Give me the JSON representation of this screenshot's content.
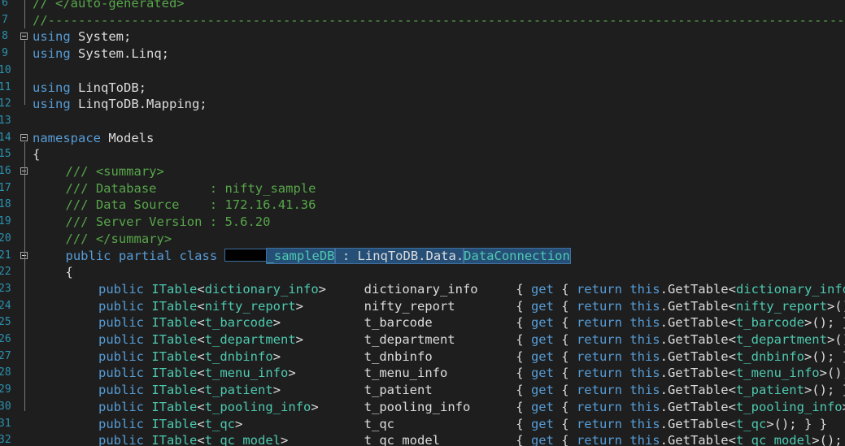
{
  "theme": {
    "background": "#1e1e1e",
    "keyword": "#569cd6",
    "comment": "#57a64a",
    "type": "#4ec9b0",
    "text": "#dcdcdc",
    "line_number": "#2b91af",
    "selection": "#264f78"
  },
  "lines": [
    {
      "num": "6",
      "fold": false,
      "indent": 0,
      "tokens": [
        {
          "t": "// </auto-generated>",
          "c": "cm"
        }
      ]
    },
    {
      "num": "7",
      "fold": false,
      "indent": 0,
      "tokens": [
        {
          "t": "//---------------------------------------------------------------------------------------------------------",
          "c": "cm"
        }
      ]
    },
    {
      "num": "8",
      "fold": true,
      "indent": 0,
      "tokens": [
        {
          "t": "using",
          "c": "kw"
        },
        {
          "t": " System;",
          "c": "tx"
        }
      ]
    },
    {
      "num": "9",
      "fold": false,
      "indent": 0,
      "tokens": [
        {
          "t": "using",
          "c": "kw"
        },
        {
          "t": " System.Linq;",
          "c": "tx"
        }
      ]
    },
    {
      "num": "10",
      "fold": false,
      "indent": 0,
      "tokens": []
    },
    {
      "num": "11",
      "fold": false,
      "indent": 0,
      "tokens": [
        {
          "t": "using",
          "c": "kw"
        },
        {
          "t": " LinqToDB;",
          "c": "tx"
        }
      ]
    },
    {
      "num": "12",
      "fold": false,
      "indent": 0,
      "tokens": [
        {
          "t": "using",
          "c": "kw"
        },
        {
          "t": " LinqToDB.Mapping;",
          "c": "tx"
        }
      ]
    },
    {
      "num": "13",
      "fold": false,
      "indent": 0,
      "tokens": []
    },
    {
      "num": "14",
      "fold": true,
      "indent": 0,
      "tokens": [
        {
          "t": "namespace",
          "c": "kw"
        },
        {
          "t": " Models",
          "c": "tx"
        }
      ]
    },
    {
      "num": "15",
      "fold": false,
      "indent": 0,
      "tokens": [
        {
          "t": "{",
          "c": "tx"
        }
      ]
    },
    {
      "num": "16",
      "fold": true,
      "indent": 1,
      "tokens": [
        {
          "t": "/// <summary>",
          "c": "cm"
        }
      ]
    },
    {
      "num": "17",
      "fold": false,
      "indent": 1,
      "tokens": [
        {
          "t": "/// Database       : nifty_sample",
          "c": "cm"
        }
      ]
    },
    {
      "num": "18",
      "fold": false,
      "indent": 1,
      "tokens": [
        {
          "t": "/// Data Source    : 172.16.41.36",
          "c": "cm"
        }
      ]
    },
    {
      "num": "19",
      "fold": false,
      "indent": 1,
      "tokens": [
        {
          "t": "/// Server Version : 5.6.20",
          "c": "cm"
        }
      ]
    },
    {
      "num": "20",
      "fold": false,
      "indent": 1,
      "tokens": [
        {
          "t": "/// </summary>",
          "c": "cm"
        }
      ]
    },
    {
      "num": "21",
      "fold": true,
      "indent": 1,
      "tokens": [
        {
          "t": "public",
          "c": "kw"
        },
        {
          "t": " ",
          "c": "tx"
        },
        {
          "t": "partial",
          "c": "kw"
        },
        {
          "t": " ",
          "c": "tx"
        },
        {
          "t": "class",
          "c": "kw"
        },
        {
          "t": " ",
          "c": "tx"
        },
        {
          "t": "",
          "c": "redact"
        },
        {
          "t": "_sampleDB",
          "c": "ty sel"
        },
        {
          "t": " : LinqToDB.Data.",
          "c": "tx sel"
        },
        {
          "t": "DataConnection",
          "c": "ty sel"
        }
      ]
    },
    {
      "num": "22",
      "fold": false,
      "indent": 1,
      "tokens": [
        {
          "t": "{",
          "c": "tx"
        }
      ]
    },
    {
      "num": "23",
      "fold": false,
      "indent": 2,
      "tokens": [
        {
          "t": "public",
          "c": "kw"
        },
        {
          "t": " ",
          "c": "tx"
        },
        {
          "t": "ITable",
          "c": "ty"
        },
        {
          "t": "<",
          "c": "tx"
        },
        {
          "t": "dictionary_info",
          "c": "ty"
        },
        {
          "t": ">     dictionary_info     { ",
          "c": "tx"
        },
        {
          "t": "get",
          "c": "kw"
        },
        {
          "t": " { ",
          "c": "tx"
        },
        {
          "t": "return",
          "c": "kw"
        },
        {
          "t": " ",
          "c": "tx"
        },
        {
          "t": "this",
          "c": "kw"
        },
        {
          "t": ".GetTable<",
          "c": "tx"
        },
        {
          "t": "dictionary_info",
          "c": "ty"
        },
        {
          "t": ">(); } }",
          "c": "tx"
        }
      ]
    },
    {
      "num": "24",
      "fold": false,
      "indent": 2,
      "tokens": [
        {
          "t": "public",
          "c": "kw"
        },
        {
          "t": " ",
          "c": "tx"
        },
        {
          "t": "ITable",
          "c": "ty"
        },
        {
          "t": "<",
          "c": "tx"
        },
        {
          "t": "nifty_report",
          "c": "ty"
        },
        {
          "t": ">        nifty_report        { ",
          "c": "tx"
        },
        {
          "t": "get",
          "c": "kw"
        },
        {
          "t": " { ",
          "c": "tx"
        },
        {
          "t": "return",
          "c": "kw"
        },
        {
          "t": " ",
          "c": "tx"
        },
        {
          "t": "this",
          "c": "kw"
        },
        {
          "t": ".GetTable<",
          "c": "tx"
        },
        {
          "t": "nifty_report",
          "c": "ty"
        },
        {
          "t": ">(); } }",
          "c": "tx"
        }
      ]
    },
    {
      "num": "25",
      "fold": false,
      "indent": 2,
      "tokens": [
        {
          "t": "public",
          "c": "kw"
        },
        {
          "t": " ",
          "c": "tx"
        },
        {
          "t": "ITable",
          "c": "ty"
        },
        {
          "t": "<",
          "c": "tx"
        },
        {
          "t": "t_barcode",
          "c": "ty"
        },
        {
          "t": ">           t_barcode           { ",
          "c": "tx"
        },
        {
          "t": "get",
          "c": "kw"
        },
        {
          "t": " { ",
          "c": "tx"
        },
        {
          "t": "return",
          "c": "kw"
        },
        {
          "t": " ",
          "c": "tx"
        },
        {
          "t": "this",
          "c": "kw"
        },
        {
          "t": ".GetTable<",
          "c": "tx"
        },
        {
          "t": "t_barcode",
          "c": "ty"
        },
        {
          "t": ">(); } }",
          "c": "tx"
        }
      ]
    },
    {
      "num": "26",
      "fold": false,
      "indent": 2,
      "tokens": [
        {
          "t": "public",
          "c": "kw"
        },
        {
          "t": " ",
          "c": "tx"
        },
        {
          "t": "ITable",
          "c": "ty"
        },
        {
          "t": "<",
          "c": "tx"
        },
        {
          "t": "t_department",
          "c": "ty"
        },
        {
          "t": ">        t_department        { ",
          "c": "tx"
        },
        {
          "t": "get",
          "c": "kw"
        },
        {
          "t": " { ",
          "c": "tx"
        },
        {
          "t": "return",
          "c": "kw"
        },
        {
          "t": " ",
          "c": "tx"
        },
        {
          "t": "this",
          "c": "kw"
        },
        {
          "t": ".GetTable<",
          "c": "tx"
        },
        {
          "t": "t_department",
          "c": "ty"
        },
        {
          "t": ">(); } }",
          "c": "tx"
        }
      ]
    },
    {
      "num": "27",
      "fold": false,
      "indent": 2,
      "tokens": [
        {
          "t": "public",
          "c": "kw"
        },
        {
          "t": " ",
          "c": "tx"
        },
        {
          "t": "ITable",
          "c": "ty"
        },
        {
          "t": "<",
          "c": "tx"
        },
        {
          "t": "t_dnbinfo",
          "c": "ty"
        },
        {
          "t": ">           t_dnbinfo           { ",
          "c": "tx"
        },
        {
          "t": "get",
          "c": "kw"
        },
        {
          "t": " { ",
          "c": "tx"
        },
        {
          "t": "return",
          "c": "kw"
        },
        {
          "t": " ",
          "c": "tx"
        },
        {
          "t": "this",
          "c": "kw"
        },
        {
          "t": ".GetTable<",
          "c": "tx"
        },
        {
          "t": "t_dnbinfo",
          "c": "ty"
        },
        {
          "t": ">(); } }",
          "c": "tx"
        }
      ]
    },
    {
      "num": "28",
      "fold": false,
      "indent": 2,
      "tokens": [
        {
          "t": "public",
          "c": "kw"
        },
        {
          "t": " ",
          "c": "tx"
        },
        {
          "t": "ITable",
          "c": "ty"
        },
        {
          "t": "<",
          "c": "tx"
        },
        {
          "t": "t_menu_info",
          "c": "ty"
        },
        {
          "t": ">         t_menu_info         { ",
          "c": "tx"
        },
        {
          "t": "get",
          "c": "kw"
        },
        {
          "t": " { ",
          "c": "tx"
        },
        {
          "t": "return",
          "c": "kw"
        },
        {
          "t": " ",
          "c": "tx"
        },
        {
          "t": "this",
          "c": "kw"
        },
        {
          "t": ".GetTable<",
          "c": "tx"
        },
        {
          "t": "t_menu_info",
          "c": "ty"
        },
        {
          "t": ">(); } }",
          "c": "tx"
        }
      ]
    },
    {
      "num": "29",
      "fold": false,
      "indent": 2,
      "tokens": [
        {
          "t": "public",
          "c": "kw"
        },
        {
          "t": " ",
          "c": "tx"
        },
        {
          "t": "ITable",
          "c": "ty"
        },
        {
          "t": "<",
          "c": "tx"
        },
        {
          "t": "t_patient",
          "c": "ty"
        },
        {
          "t": ">           t_patient           { ",
          "c": "tx"
        },
        {
          "t": "get",
          "c": "kw"
        },
        {
          "t": " { ",
          "c": "tx"
        },
        {
          "t": "return",
          "c": "kw"
        },
        {
          "t": " ",
          "c": "tx"
        },
        {
          "t": "this",
          "c": "kw"
        },
        {
          "t": ".GetTable<",
          "c": "tx"
        },
        {
          "t": "t_patient",
          "c": "ty"
        },
        {
          "t": ">(); } }",
          "c": "tx"
        }
      ]
    },
    {
      "num": "30",
      "fold": false,
      "indent": 2,
      "tokens": [
        {
          "t": "public",
          "c": "kw"
        },
        {
          "t": " ",
          "c": "tx"
        },
        {
          "t": "ITable",
          "c": "ty"
        },
        {
          "t": "<",
          "c": "tx"
        },
        {
          "t": "t_pooling_info",
          "c": "ty"
        },
        {
          "t": ">      t_pooling_info      { ",
          "c": "tx"
        },
        {
          "t": "get",
          "c": "kw"
        },
        {
          "t": " { ",
          "c": "tx"
        },
        {
          "t": "return",
          "c": "kw"
        },
        {
          "t": " ",
          "c": "tx"
        },
        {
          "t": "this",
          "c": "kw"
        },
        {
          "t": ".GetTable<",
          "c": "tx"
        },
        {
          "t": "t_pooling_info",
          "c": "ty"
        },
        {
          "t": ">(); } }",
          "c": "tx"
        }
      ]
    },
    {
      "num": "31",
      "fold": false,
      "indent": 2,
      "tokens": [
        {
          "t": "public",
          "c": "kw"
        },
        {
          "t": " ",
          "c": "tx"
        },
        {
          "t": "ITable",
          "c": "ty"
        },
        {
          "t": "<",
          "c": "tx"
        },
        {
          "t": "t_qc",
          "c": "ty"
        },
        {
          "t": ">                t_qc                { ",
          "c": "tx"
        },
        {
          "t": "get",
          "c": "kw"
        },
        {
          "t": " { ",
          "c": "tx"
        },
        {
          "t": "return",
          "c": "kw"
        },
        {
          "t": " ",
          "c": "tx"
        },
        {
          "t": "this",
          "c": "kw"
        },
        {
          "t": ".GetTable<",
          "c": "tx"
        },
        {
          "t": "t_qc",
          "c": "ty"
        },
        {
          "t": ">(); } }",
          "c": "tx"
        }
      ]
    },
    {
      "num": "32",
      "fold": false,
      "indent": 2,
      "tokens": [
        {
          "t": "public",
          "c": "kw"
        },
        {
          "t": " ",
          "c": "tx"
        },
        {
          "t": "ITable",
          "c": "ty"
        },
        {
          "t": "<",
          "c": "tx"
        },
        {
          "t": "t_qc_model",
          "c": "ty"
        },
        {
          "t": ">          t_qc_model          { ",
          "c": "tx"
        },
        {
          "t": "get",
          "c": "kw"
        },
        {
          "t": " { ",
          "c": "tx"
        },
        {
          "t": "return",
          "c": "kw"
        },
        {
          "t": " ",
          "c": "tx"
        },
        {
          "t": "this",
          "c": "kw"
        },
        {
          "t": ".GetTable<",
          "c": "tx"
        },
        {
          "t": "t_qc_model",
          "c": "ty"
        },
        {
          "t": ">(); } }",
          "c": "tx"
        }
      ]
    }
  ]
}
